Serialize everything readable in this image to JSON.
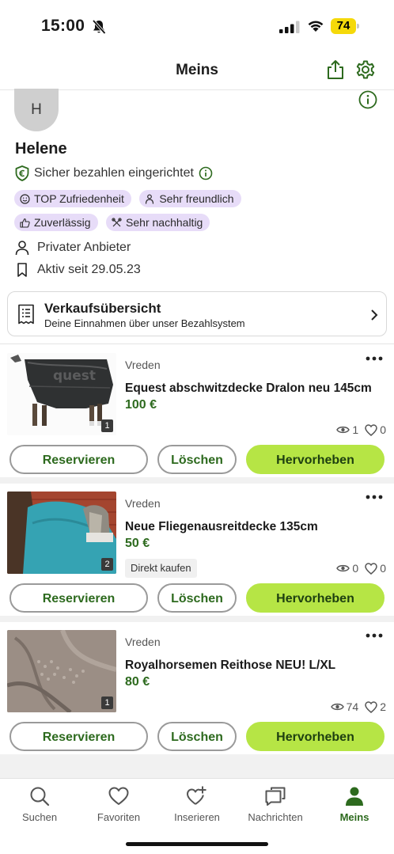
{
  "status": {
    "time": "15:00",
    "battery": "74"
  },
  "header": {
    "title": "Meins"
  },
  "profile": {
    "avatar_initial": "H",
    "name": "Helene",
    "secure_payment": "Sicher bezahlen eingerichtet",
    "badges": [
      "TOP Zufriedenheit",
      "Sehr freundlich",
      "Zuverlässig",
      "Sehr nachhaltig"
    ],
    "seller_type": "Privater Anbieter",
    "active_since": "Aktiv seit 29.05.23"
  },
  "sales_overview": {
    "title": "Verkaufsübersicht",
    "subtitle": "Deine Einnahmen über unser Bezahlsystem"
  },
  "listings": [
    {
      "location": "Vreden",
      "title": "Equest abschwitzdecke Dralon neu 145cm",
      "price": "100 €",
      "image_count": "1",
      "views": "1",
      "likes": "0",
      "tag": ""
    },
    {
      "location": "Vreden",
      "title": "Neue Fliegenausreitdecke 135cm",
      "price": "50 €",
      "image_count": "2",
      "views": "0",
      "likes": "0",
      "tag": "Direkt kaufen"
    },
    {
      "location": "Vreden",
      "title": "Royalhorsemen Reithose NEU! L/XL",
      "price": "80 €",
      "image_count": "1",
      "views": "74",
      "likes": "2",
      "tag": ""
    }
  ],
  "actions": {
    "reserve": "Reservieren",
    "delete": "Löschen",
    "highlight": "Hervorheben"
  },
  "tabs": [
    {
      "label": "Suchen",
      "icon": "search-icon",
      "active": false
    },
    {
      "label": "Favoriten",
      "icon": "heart-icon",
      "active": false
    },
    {
      "label": "Inserieren",
      "icon": "heart-plus-icon",
      "active": false
    },
    {
      "label": "Nachrichten",
      "icon": "chat-icon",
      "active": false
    },
    {
      "label": "Meins",
      "icon": "person-icon",
      "active": true
    }
  ],
  "colors": {
    "accent": "#2d6a1e",
    "highlight_button": "#b6e545",
    "badge_bg": "#e7dcf8",
    "battery": "#f5d90a"
  }
}
